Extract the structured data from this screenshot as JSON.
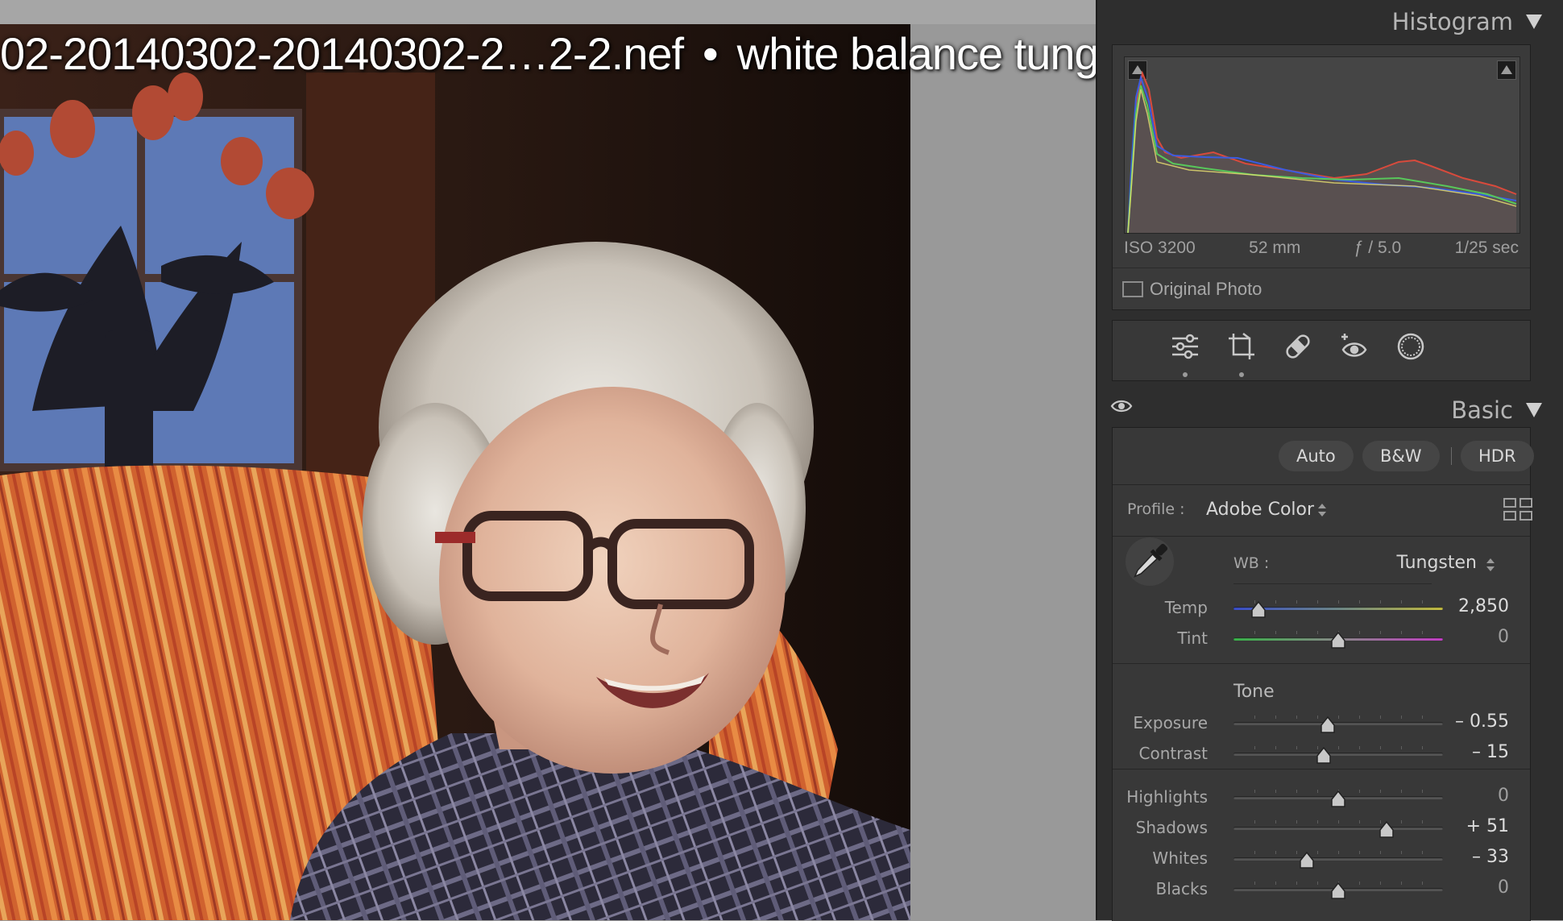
{
  "overlay": {
    "filename": "02-20140302-20140302-2…2-2.nef",
    "separator": "•",
    "caption": "white balance tungsten"
  },
  "histogram": {
    "title": "Histogram",
    "exif": {
      "iso": "ISO 3200",
      "focal": "52 mm",
      "aperture": "ƒ / 5.0",
      "shutter": "1/25 sec"
    },
    "original_photo_label": "Original Photo",
    "original_photo_checked": false
  },
  "tools": [
    {
      "name": "edit-sliders-icon",
      "active": true
    },
    {
      "name": "crop-icon",
      "active": true
    },
    {
      "name": "healing-bandage-icon",
      "active": false
    },
    {
      "name": "red-eye-icon",
      "active": false
    },
    {
      "name": "masking-icon",
      "active": false
    }
  ],
  "basic": {
    "title": "Basic",
    "auto": "Auto",
    "bw": "B&W",
    "hdr": "HDR",
    "profile_label": "Profile :",
    "profile_value": "Adobe Color",
    "wb_label": "WB :",
    "wb_value": "Tungsten",
    "tone_label": "Tone",
    "sliders": {
      "temp": {
        "label": "Temp",
        "value": "2,850",
        "position": 0.12
      },
      "tint": {
        "label": "Tint",
        "value": "0",
        "position": 0.5
      },
      "exposure": {
        "label": "Exposure",
        "value": "– 0.55",
        "position": 0.45
      },
      "contrast": {
        "label": "Contrast",
        "value": "– 15",
        "position": 0.43
      },
      "highlights": {
        "label": "Highlights",
        "value": "0",
        "position": 0.5
      },
      "shadows": {
        "label": "Shadows",
        "value": "+ 51",
        "position": 0.73
      },
      "whites": {
        "label": "Whites",
        "value": "– 33",
        "position": 0.35
      },
      "blacks": {
        "label": "Blacks",
        "value": "0",
        "position": 0.5
      }
    }
  },
  "colors": {
    "panel_bg": "#2e2e2e",
    "section_bg": "#383838",
    "canvas_bg": "#999999",
    "temp_gradient": [
      "#3a4fd0",
      "#c8c040"
    ],
    "tint_gradient": [
      "#39b54a",
      "#c63fc8"
    ]
  }
}
